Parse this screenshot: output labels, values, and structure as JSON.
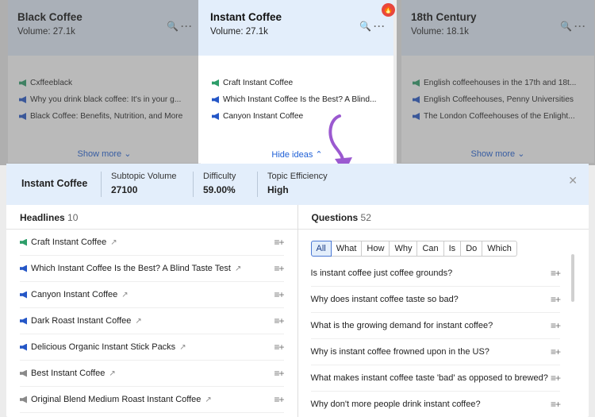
{
  "cards": [
    {
      "title": "Black Coffee",
      "volume": "Volume: 27.1k",
      "items": [
        {
          "text": "Cxffeeblack",
          "marker": "green"
        },
        {
          "text": "Why you drink black coffee: It's in your g...",
          "marker": "blue"
        },
        {
          "text": "Black Coffee: Benefits, Nutrition, and More",
          "marker": "blue"
        }
      ],
      "footer": "Show more ⌄"
    },
    {
      "title": "Instant Coffee",
      "volume": "Volume: 27.1k",
      "items": [
        {
          "text": "Craft Instant Coffee",
          "marker": "green"
        },
        {
          "text": "Which Instant Coffee Is the Best? A Blind...",
          "marker": "blue"
        },
        {
          "text": "Canyon Instant Coffee",
          "marker": "blue"
        }
      ],
      "footer": "Hide ideas ⌃"
    },
    {
      "title": "18th Century",
      "volume": "Volume: 18.1k",
      "items": [
        {
          "text": "English coffeehouses in the 17th and 18t...",
          "marker": "green"
        },
        {
          "text": "English Coffeehouses, Penny Universities",
          "marker": "blue"
        },
        {
          "text": "The London Coffeehouses of the Enlight...",
          "marker": "blue"
        }
      ],
      "footer": "Show more ⌄"
    }
  ],
  "panel": {
    "title": "Instant Coffee",
    "metrics": [
      {
        "label": "Subtopic Volume",
        "value": "27100"
      },
      {
        "label": "Difficulty",
        "value": "59.00%"
      },
      {
        "label": "Topic Efficiency",
        "value": "High"
      }
    ],
    "headlines_label": "Headlines",
    "headlines_count": "10",
    "headlines": [
      {
        "text": "Craft Instant Coffee",
        "marker": "green"
      },
      {
        "text": "Which Instant Coffee Is the Best? A Blind Taste Test",
        "marker": "blue"
      },
      {
        "text": "Canyon Instant Coffee",
        "marker": "blue"
      },
      {
        "text": "Dark Roast Instant Coffee",
        "marker": "blue"
      },
      {
        "text": "Delicious Organic Instant Stick Packs",
        "marker": "blue"
      },
      {
        "text": "Best Instant Coffee",
        "marker": "gray"
      },
      {
        "text": "Original Blend Medium Roast Instant Coffee",
        "marker": "gray"
      }
    ],
    "questions_label": "Questions",
    "questions_count": "52",
    "filters": [
      "All",
      "What",
      "How",
      "Why",
      "Can",
      "Is",
      "Do",
      "Which"
    ],
    "questions": [
      "Is instant coffee just coffee grounds?",
      "Why does instant coffee taste so bad?",
      "What is the growing demand for instant coffee?",
      "Why is instant coffee frowned upon in the US?",
      "What makes instant coffee taste 'bad' as opposed to brewed?",
      "Why don't more people drink instant coffee?"
    ]
  },
  "badge_text": "🔥",
  "colors": {
    "green": "#2e9e6a",
    "blue": "#2557c7",
    "gray": "#8a8a8a",
    "accent": "#1e5fd6",
    "arrow": "#9b59d0"
  }
}
